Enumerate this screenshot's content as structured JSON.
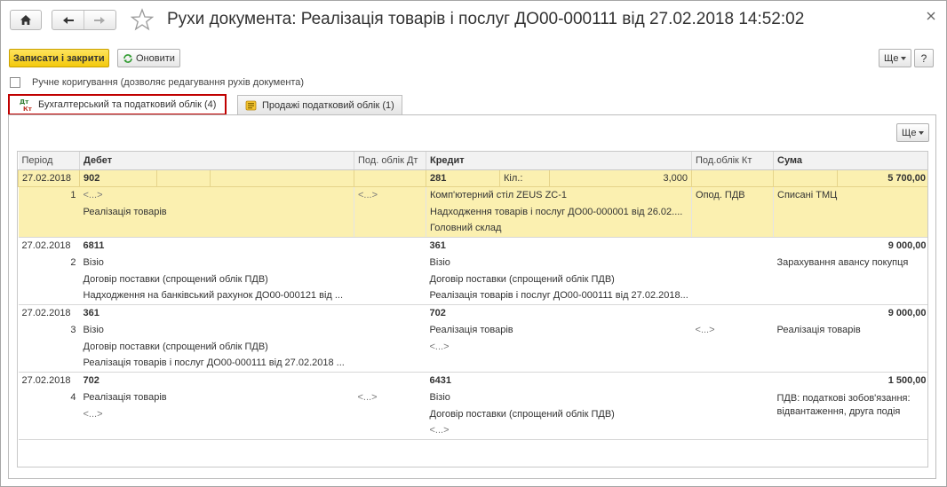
{
  "window": {
    "title": "Рухи документа: Реалізація товарів і послуг ДО00-000111 від 27.02.2018 14:52:02"
  },
  "toolbar": {
    "save_close": "Записати і закрити",
    "refresh": "Оновити",
    "more": "Ще",
    "help": "?"
  },
  "manual": {
    "label": "Ручне коригування (дозволяє редагування рухів документа)"
  },
  "tabs": [
    {
      "label": "Бухгалтерський та податковий облік (4)"
    },
    {
      "label": "Продажі податковий облік (1)"
    }
  ],
  "panel": {
    "more": "Ще"
  },
  "table": {
    "headers": {
      "period": "Період",
      "debit": "Дебет",
      "tax_dt": "Под. облік Дт",
      "credit": "Кредит",
      "tax_kt": "Под.облік Кт",
      "sum": "Сума"
    },
    "rows": [
      {
        "date": "27.02.2018",
        "num": "1",
        "debit_account": "902",
        "debit_sub": [
          "<...>",
          "Реалізація товарів"
        ],
        "tax_dt": "<...>",
        "credit_account": "281",
        "qty_label": "Кіл.:",
        "qty": "3,000",
        "credit_sub": [
          "Комп'ютерний стіл ZEUS ZC-1",
          "Надходження товарів і послуг ДО00-000001 від 26.02....",
          "Головний склад"
        ],
        "tax_kt": "Опод. ПДВ",
        "sum": "5 700,00",
        "content": "Списані ТМЦ"
      },
      {
        "date": "27.02.2018",
        "num": "2",
        "debit_account": "6811",
        "debit_sub": [
          "Візіо",
          "Договір поставки (спрощений облік ПДВ)",
          "Надходження на банківський рахунок ДО00-000121 від ..."
        ],
        "tax_dt": "",
        "credit_account": "361",
        "credit_sub": [
          "Візіо",
          "Договір поставки (спрощений облік ПДВ)",
          "Реалізація товарів і послуг ДО00-000111 від 27.02.2018..."
        ],
        "tax_kt": "",
        "sum": "9 000,00",
        "content": "Зарахування авансу покупця"
      },
      {
        "date": "27.02.2018",
        "num": "3",
        "debit_account": "361",
        "debit_sub": [
          "Візіо",
          "Договір поставки (спрощений облік ПДВ)",
          "Реалізація товарів і послуг ДО00-000111 від 27.02.2018 ..."
        ],
        "tax_dt": "",
        "credit_account": "702",
        "credit_sub": [
          "Реалізація товарів",
          "<...>"
        ],
        "tax_kt": "<...>",
        "sum": "9 000,00",
        "content": "Реалізація товарів"
      },
      {
        "date": "27.02.2018",
        "num": "4",
        "debit_account": "702",
        "debit_sub": [
          "Реалізація товарів",
          "<...>"
        ],
        "tax_dt": "<...>",
        "credit_account": "6431",
        "credit_sub": [
          "Візіо",
          "Договір поставки (спрощений облік ПДВ)",
          "<...>"
        ],
        "tax_kt": "",
        "sum": "1 500,00",
        "content": "ПДВ: податкові зобов'язання: відвантаження, друга подія"
      }
    ]
  },
  "colors": {
    "primary_button": "#f3c90d",
    "selected_row": "#fbf0b0",
    "active_tab_border": "#c00000"
  },
  "icons": {
    "home": "home-icon",
    "back": "arrow-left-icon",
    "forward": "arrow-right-icon",
    "favorite": "star-icon",
    "close": "close-icon",
    "refresh": "refresh-icon",
    "tab_accounting": "dt-kt-icon",
    "tab_sales": "register-icon"
  }
}
